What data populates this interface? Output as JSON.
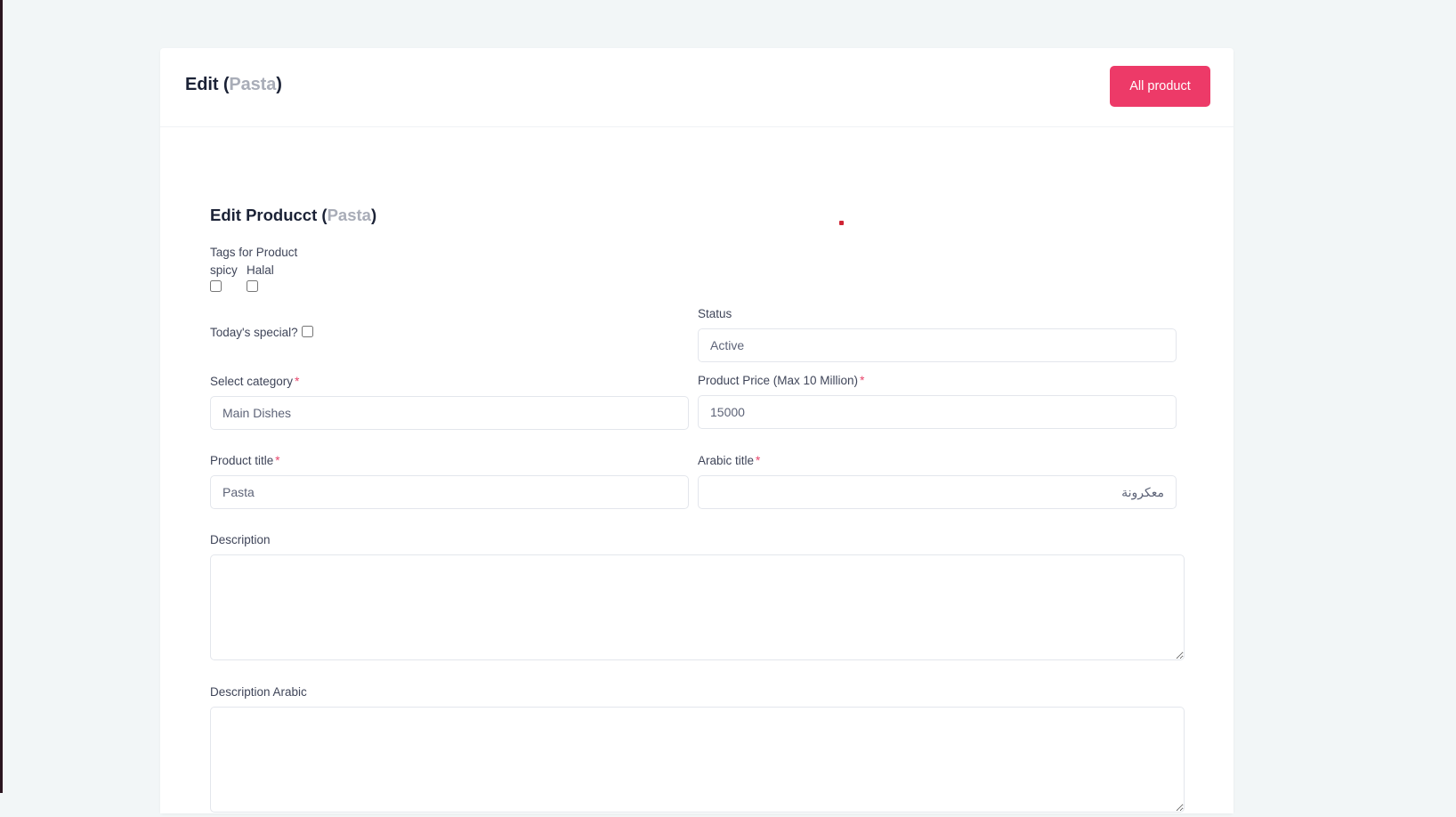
{
  "header": {
    "title_main": "Edit (",
    "title_value": "Pasta",
    "title_end": ")",
    "all_product_label": "All product"
  },
  "form": {
    "section_title_main": "Edit Producct (",
    "section_title_value": "Pasta",
    "section_title_end": ")",
    "tags_label": "Tags for Product",
    "tags": [
      {
        "name": "spicy",
        "checked": false
      },
      {
        "name": "Halal",
        "checked": false
      }
    ],
    "todays_special_label": "Today's special?",
    "todays_special_checked": false,
    "fields": {
      "status": {
        "label": "Status",
        "value": "Active",
        "required": false
      },
      "category": {
        "label": "Select category",
        "value": "Main Dishes",
        "required": true,
        "required_marker": "*"
      },
      "price": {
        "label": "Product Price (Max 10 Million)",
        "value": "15000",
        "required": true,
        "required_marker": "*"
      },
      "product_title": {
        "label": "Product title",
        "value": "Pasta",
        "required": true,
        "required_marker": "*"
      },
      "arabic_title": {
        "label": "Arabic title",
        "value": "معكرونة",
        "required": true,
        "required_marker": "*"
      },
      "description": {
        "label": "Description",
        "value": ""
      },
      "description_arabic": {
        "label": "Description Arabic",
        "value": ""
      }
    }
  },
  "colors": {
    "accent": "#ed3a68",
    "required": "#e8456b",
    "page_background": "#f2f6f7",
    "card_background": "#ffffff",
    "text": "#1b2236",
    "muted_text": "#a9adb8",
    "marker_dot": "#cf2434"
  }
}
